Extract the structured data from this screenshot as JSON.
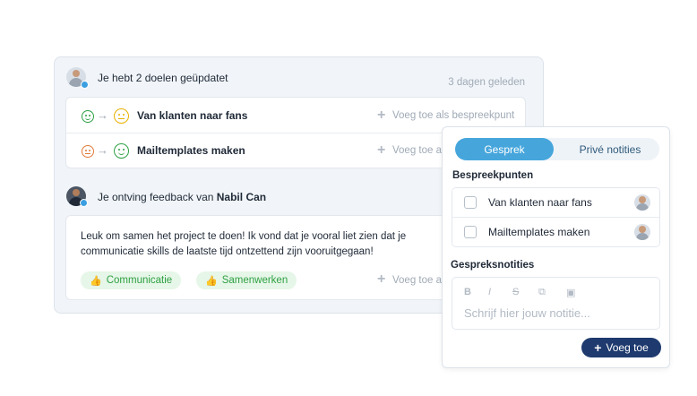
{
  "feed": {
    "item1": {
      "title": "Je hebt 2 doelen geüpdatet",
      "time": "3 dagen geleden",
      "goals": [
        {
          "label": "Van klanten naar fans",
          "from": "green-happy-icon",
          "to": "yellow-neutral-icon",
          "action": "Voeg toe als bespreekpunt"
        },
        {
          "label": "Mailtemplates maken",
          "from": "orange-neutral-icon",
          "to": "green-happy-icon",
          "action": "Voeg toe a"
        }
      ]
    },
    "item2": {
      "title_prefix": "Je ontving feedback van ",
      "title_name": "Nabil Can",
      "message_line1": "Leuk om samen het project te doen! Ik vond dat je vooral liet zien dat je",
      "message_line2": "communicatie skills de laatste tijd ontzettend zijn vooruitgegaan!",
      "tags": [
        "Communicatie",
        "Samenwerken"
      ],
      "action": "Voeg toe a"
    }
  },
  "panel": {
    "tabs": [
      "Gesprek",
      "Privé notities"
    ],
    "active_tab": "Gesprek",
    "bespreekpunten_title": "Bespreekpunten",
    "bespreekpunten": [
      "Van klanten naar fans",
      "Mailtemplates maken"
    ],
    "notes_title": "Gespreksnotities",
    "toolbar": [
      "B",
      "I",
      "S",
      "⧉",
      "▣"
    ],
    "placeholder": "Schrijf hier jouw notitie...",
    "add_label": "Voeg toe"
  },
  "colors": {
    "accent": "#46a6dc",
    "button": "#1e3a6e",
    "tag_bg": "#e6f6e8",
    "tag_text": "#2ea043"
  }
}
